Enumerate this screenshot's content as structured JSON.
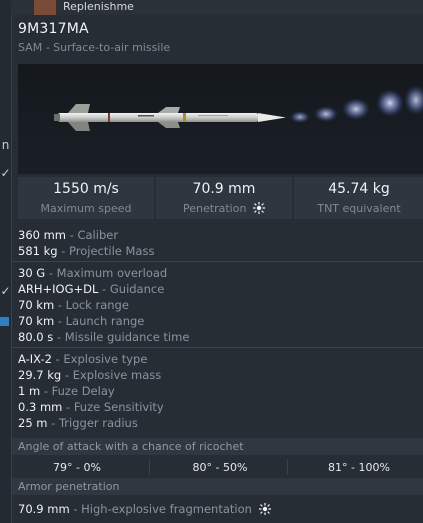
{
  "background": {
    "header_label": "Replenishme",
    "left_marks": [
      "n",
      "✓",
      "✓"
    ]
  },
  "tooltip": {
    "title": "9M317MA",
    "subtitle": "SAM - Surface-to-air missile",
    "stats": [
      {
        "value": "1550 m/s",
        "label": "Maximum speed"
      },
      {
        "value": "70.9 mm",
        "label": "Penetration"
      },
      {
        "value": "45.74 kg",
        "label": "TNT equivalent"
      }
    ],
    "group1": [
      {
        "value": "360 mm",
        "label": " - Caliber"
      },
      {
        "value": "581 kg",
        "label": " - Projectile Mass"
      }
    ],
    "group2": [
      {
        "value": "30 G",
        "label": " - Maximum overload"
      },
      {
        "value": "ARH+IOG+DL",
        "label": " - Guidance"
      },
      {
        "value": "70 km",
        "label": " - Lock range"
      },
      {
        "value": "70 km",
        "label": " - Launch range"
      },
      {
        "value": "80.0 s",
        "label": " - Missile guidance time"
      }
    ],
    "group3": [
      {
        "value": "A-IX-2",
        "label": " - Explosive type"
      },
      {
        "value": "29.7 kg",
        "label": " - Explosive mass"
      },
      {
        "value": "1 m",
        "label": " - Fuze Delay"
      },
      {
        "value": "0.3 mm",
        "label": " - Fuze Sensitivity"
      },
      {
        "value": "25 m",
        "label": " - Trigger radius"
      }
    ],
    "ricochet": {
      "heading": "Angle of attack with a chance of ricochet",
      "cells": [
        "79° - 0%",
        "80° - 50%",
        "81° - 100%"
      ]
    },
    "armor": {
      "heading": "Armor penetration",
      "value": "70.9 mm",
      "label": " - High-explosive fragmentation"
    }
  }
}
